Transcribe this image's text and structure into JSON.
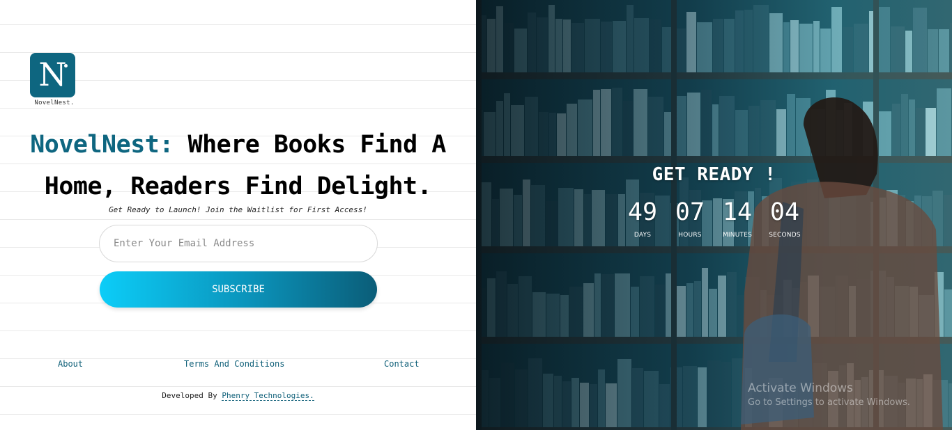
{
  "brand": {
    "logo_letter": "N",
    "logo_caption": "NovelNest."
  },
  "hero": {
    "headline_brand": "NovelNest:",
    "headline_rest_line1": "Where Books Find A",
    "headline_line2": "Home, Readers Find Delight.",
    "tagline": "Get Ready to Launch! Join the Waitlist for First Access!"
  },
  "form": {
    "email_placeholder": "Enter Your Email Address",
    "subscribe_label": "SUBSCRIBE"
  },
  "footer": {
    "links": [
      "About",
      "Terms And Conditions",
      "Contact"
    ],
    "developed_by": "Developed By",
    "developer": "Phenry Technologies."
  },
  "countdown": {
    "title": "GET READY !",
    "days": "49",
    "hours": "07",
    "minutes": "14",
    "seconds": "04",
    "days_label": "DAYS",
    "hours_label": "HOURS",
    "minutes_label": "MINUTES",
    "seconds_label": "SECONDS"
  },
  "watermark": {
    "line1": "Activate Windows",
    "line2": "Go to Settings to activate Windows."
  },
  "colors": {
    "brand": "#0e6680",
    "button_start": "#0ccdf8",
    "button_end": "#0b5d78"
  }
}
